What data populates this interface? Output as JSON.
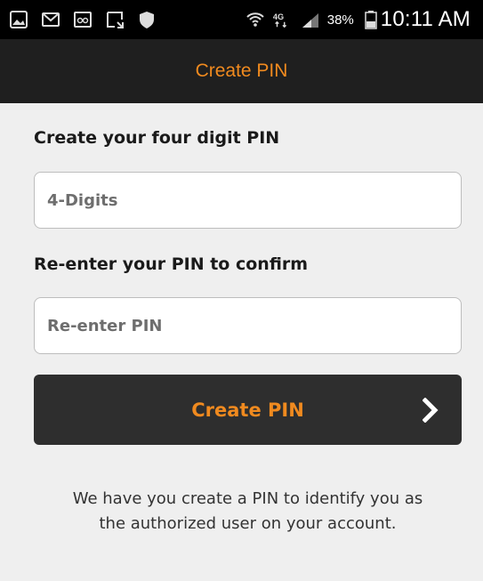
{
  "status_bar": {
    "battery_percent": "38%",
    "time": "10:11 AM",
    "network_label": "4G",
    "left_icons": [
      "image-icon",
      "mail-icon",
      "voicemail-icon",
      "screenshot-icon",
      "shield-icon"
    ]
  },
  "header": {
    "title": "Create PIN"
  },
  "form": {
    "pin_label": "Create your four digit PIN",
    "pin_placeholder": "4-Digits",
    "confirm_label": "Re-enter your PIN to confirm",
    "confirm_placeholder": "Re-enter PIN",
    "submit_label": "Create PIN"
  },
  "footnote": {
    "line1": "We have you create a PIN to identify you as",
    "line2": "the authorized user on your account."
  },
  "colors": {
    "accent": "#f08a1f",
    "header_bg": "#1f1f1f",
    "button_bg": "#2e2e2e",
    "page_bg": "#efefef"
  }
}
